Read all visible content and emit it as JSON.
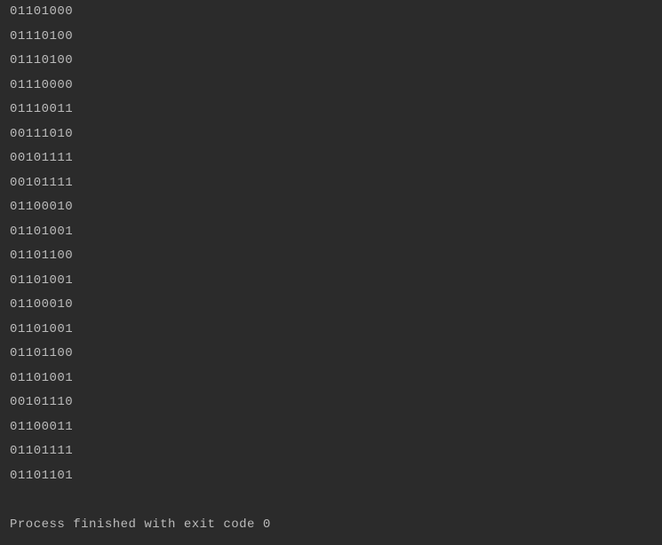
{
  "console": {
    "lines": [
      "01101000",
      "01110100",
      "01110100",
      "01110000",
      "01110011",
      "00111010",
      "00101111",
      "00101111",
      "01100010",
      "01101001",
      "01101100",
      "01101001",
      "01100010",
      "01101001",
      "01101100",
      "01101001",
      "00101110",
      "01100011",
      "01101111",
      "01101101"
    ],
    "exit_message": "Process finished with exit code 0"
  }
}
